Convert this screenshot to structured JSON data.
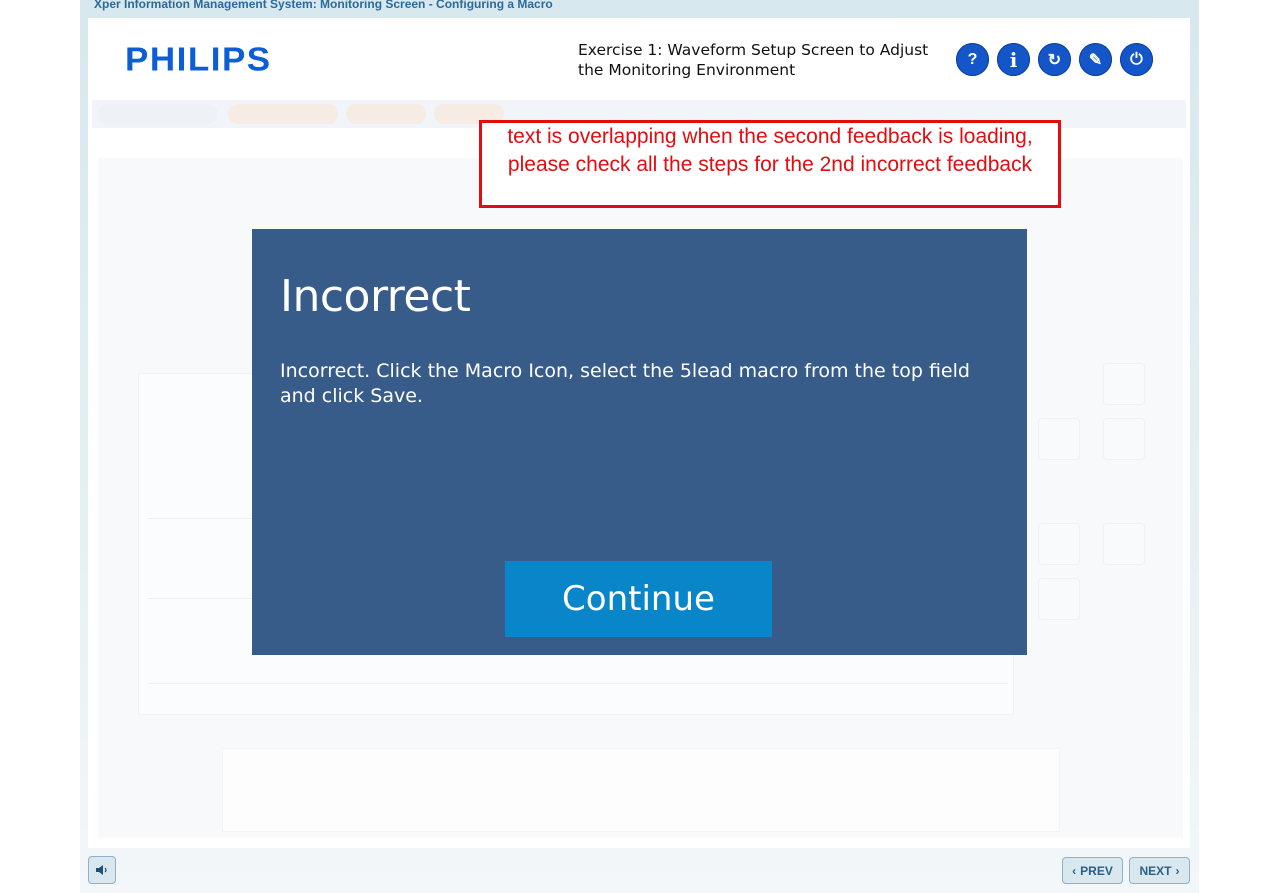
{
  "window": {
    "title": "Xper Information Management System: Monitoring Screen - Configuring a Macro"
  },
  "header": {
    "logo": "PHILIPS",
    "exercise_title": "Exercise 1: Waveform Setup Screen to Adjust the Monitoring Environment",
    "buttons": [
      {
        "name": "help",
        "glyph": "?"
      },
      {
        "name": "info",
        "glyph": "i"
      },
      {
        "name": "replay",
        "glyph": "↻"
      },
      {
        "name": "pen",
        "glyph": "✎"
      },
      {
        "name": "power",
        "glyph": "⏻"
      }
    ]
  },
  "annotation": {
    "text": "text is overlapping when the second feedback is loading, please check all the steps for the 2nd incorrect feedback",
    "color": "#e10d10"
  },
  "modal": {
    "title": "Incorrect",
    "body": "Incorrect. Click the Macro Icon, select the 5lead macro from the top field and click Save.",
    "continue_label": "Continue",
    "background": "#375c89",
    "button_color": "#0986c9"
  },
  "footer": {
    "audio_icon": "speaker-icon",
    "prev_label": "PREV",
    "next_label": "NEXT"
  }
}
